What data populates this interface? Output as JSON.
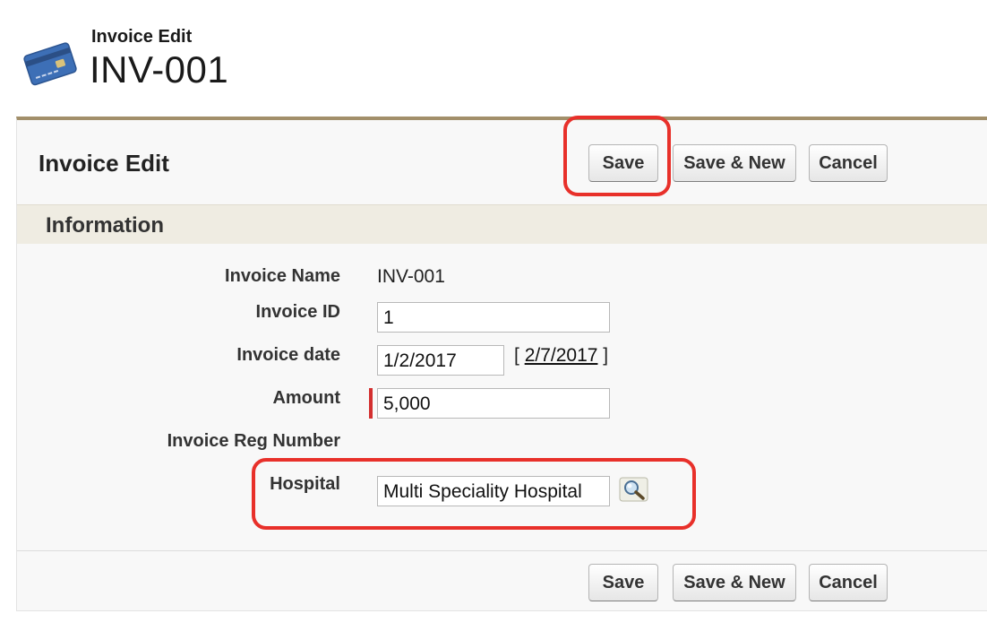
{
  "header": {
    "subtitle": "Invoice Edit",
    "title": "INV-001",
    "icon": "credit-card-icon"
  },
  "panel": {
    "title": "Invoice Edit",
    "buttons": {
      "save": "Save",
      "save_new": "Save & New",
      "cancel": "Cancel"
    }
  },
  "section": {
    "title": "Information"
  },
  "fields": {
    "invoice_name": {
      "label": "Invoice Name",
      "value": "INV-001"
    },
    "invoice_id": {
      "label": "Invoice ID",
      "value": "1"
    },
    "invoice_date": {
      "label": "Invoice date",
      "value": "1/2/2017",
      "today_link": "2/7/2017",
      "bracket_open": "[",
      "bracket_close": "]"
    },
    "amount": {
      "label": "Amount",
      "value": "5,000",
      "required": true
    },
    "invoice_reg_number": {
      "label": "Invoice Reg Number"
    },
    "hospital": {
      "label": "Hospital",
      "value": "Multi Speciality Hospital",
      "lookup_icon": "magnifier-lookup-icon"
    }
  },
  "colors": {
    "panel_accent": "#a28f6a",
    "section_bg": "#efece2",
    "highlight": "#e8302a",
    "required": "#d32f2f"
  }
}
